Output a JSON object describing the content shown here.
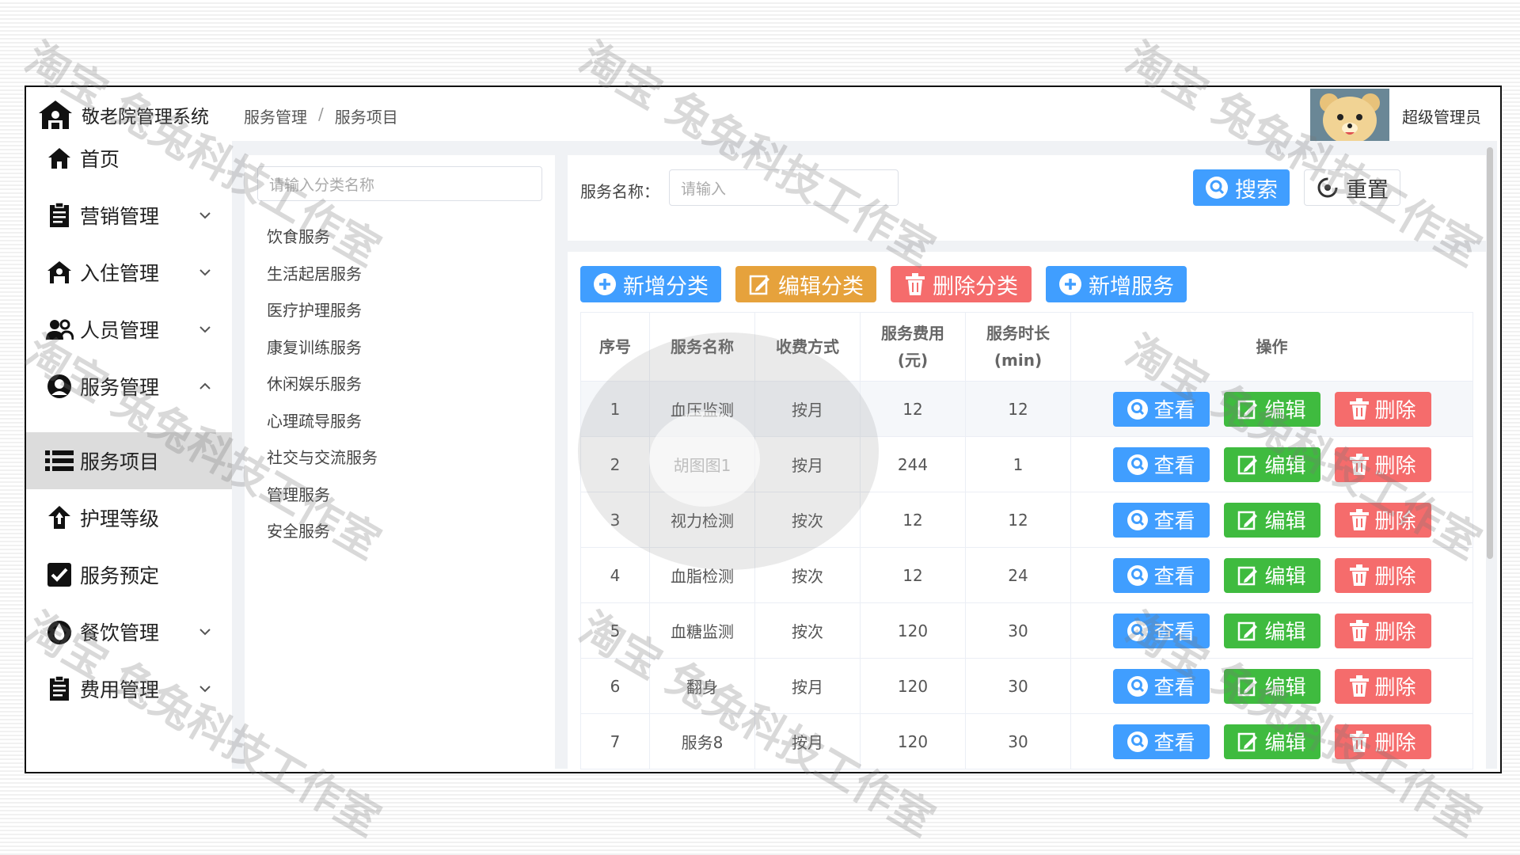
{
  "app": {
    "title": "敬老院管理系统"
  },
  "breadcrumb": [
    "服务管理",
    "服务项目"
  ],
  "breadcrumb_sep": "/",
  "user": {
    "name": "超级管理员"
  },
  "sidebar": {
    "items": [
      {
        "label": "首页",
        "icon": "home-icon"
      },
      {
        "label": "营销管理",
        "icon": "clipboard-icon",
        "expanded": false
      },
      {
        "label": "入住管理",
        "icon": "house-icon",
        "expanded": false
      },
      {
        "label": "人员管理",
        "icon": "users-icon",
        "expanded": false
      },
      {
        "label": "服务管理",
        "icon": "headset-icon",
        "expanded": true
      },
      {
        "label": "服务项目",
        "icon": "list-icon",
        "active": true
      },
      {
        "label": "护理等级",
        "icon": "upload-house-icon"
      },
      {
        "label": "服务预定",
        "icon": "check-square-icon"
      },
      {
        "label": "餐饮管理",
        "icon": "drop-icon",
        "expanded": false
      },
      {
        "label": "费用管理",
        "icon": "clipboard-icon",
        "expanded": false
      }
    ]
  },
  "category": {
    "placeholder": "请输入分类名称",
    "items": [
      "饮食服务",
      "生活起居服务",
      "医疗护理服务",
      "康复训练服务",
      "休闲娱乐服务",
      "心理疏导服务",
      "社交与交流服务",
      "管理服务",
      "安全服务"
    ]
  },
  "search": {
    "label": "服务名称：",
    "placeholder": "请输入",
    "search_label": "搜索",
    "reset_label": "重置"
  },
  "toolbar": {
    "add_category": "新增分类",
    "edit_category": "编辑分类",
    "delete_category": "删除分类",
    "add_service": "新增服务"
  },
  "table": {
    "headers": [
      "序号",
      "服务名称",
      "收费方式",
      "服务费用(元)",
      "服务时长(min)",
      "操作"
    ],
    "header_fee": [
      "服务费用",
      "(元)"
    ],
    "header_duration": [
      "服务时长",
      "(min)"
    ],
    "rows": [
      [
        "1",
        "血压监测",
        "按月",
        "12",
        "12"
      ],
      [
        "2",
        "胡图图1",
        "按月",
        "244",
        "1"
      ],
      [
        "3",
        "视力检测",
        "按次",
        "12",
        "12"
      ],
      [
        "4",
        "血脂检测",
        "按次",
        "12",
        "24"
      ],
      [
        "5",
        "血糖监测",
        "按次",
        "120",
        "30"
      ],
      [
        "6",
        "翻身",
        "按月",
        "120",
        "30"
      ],
      [
        "7",
        "服务8",
        "按月",
        "120",
        "30"
      ]
    ],
    "op_view": "查看",
    "op_edit": "编辑",
    "op_delete": "删除"
  },
  "watermark": "淘宝 兔兔科技工作室",
  "colors": {
    "primary": "#409eff",
    "warning": "#e6a23c",
    "danger": "#f56c6c",
    "success": "#3fbb3f"
  }
}
